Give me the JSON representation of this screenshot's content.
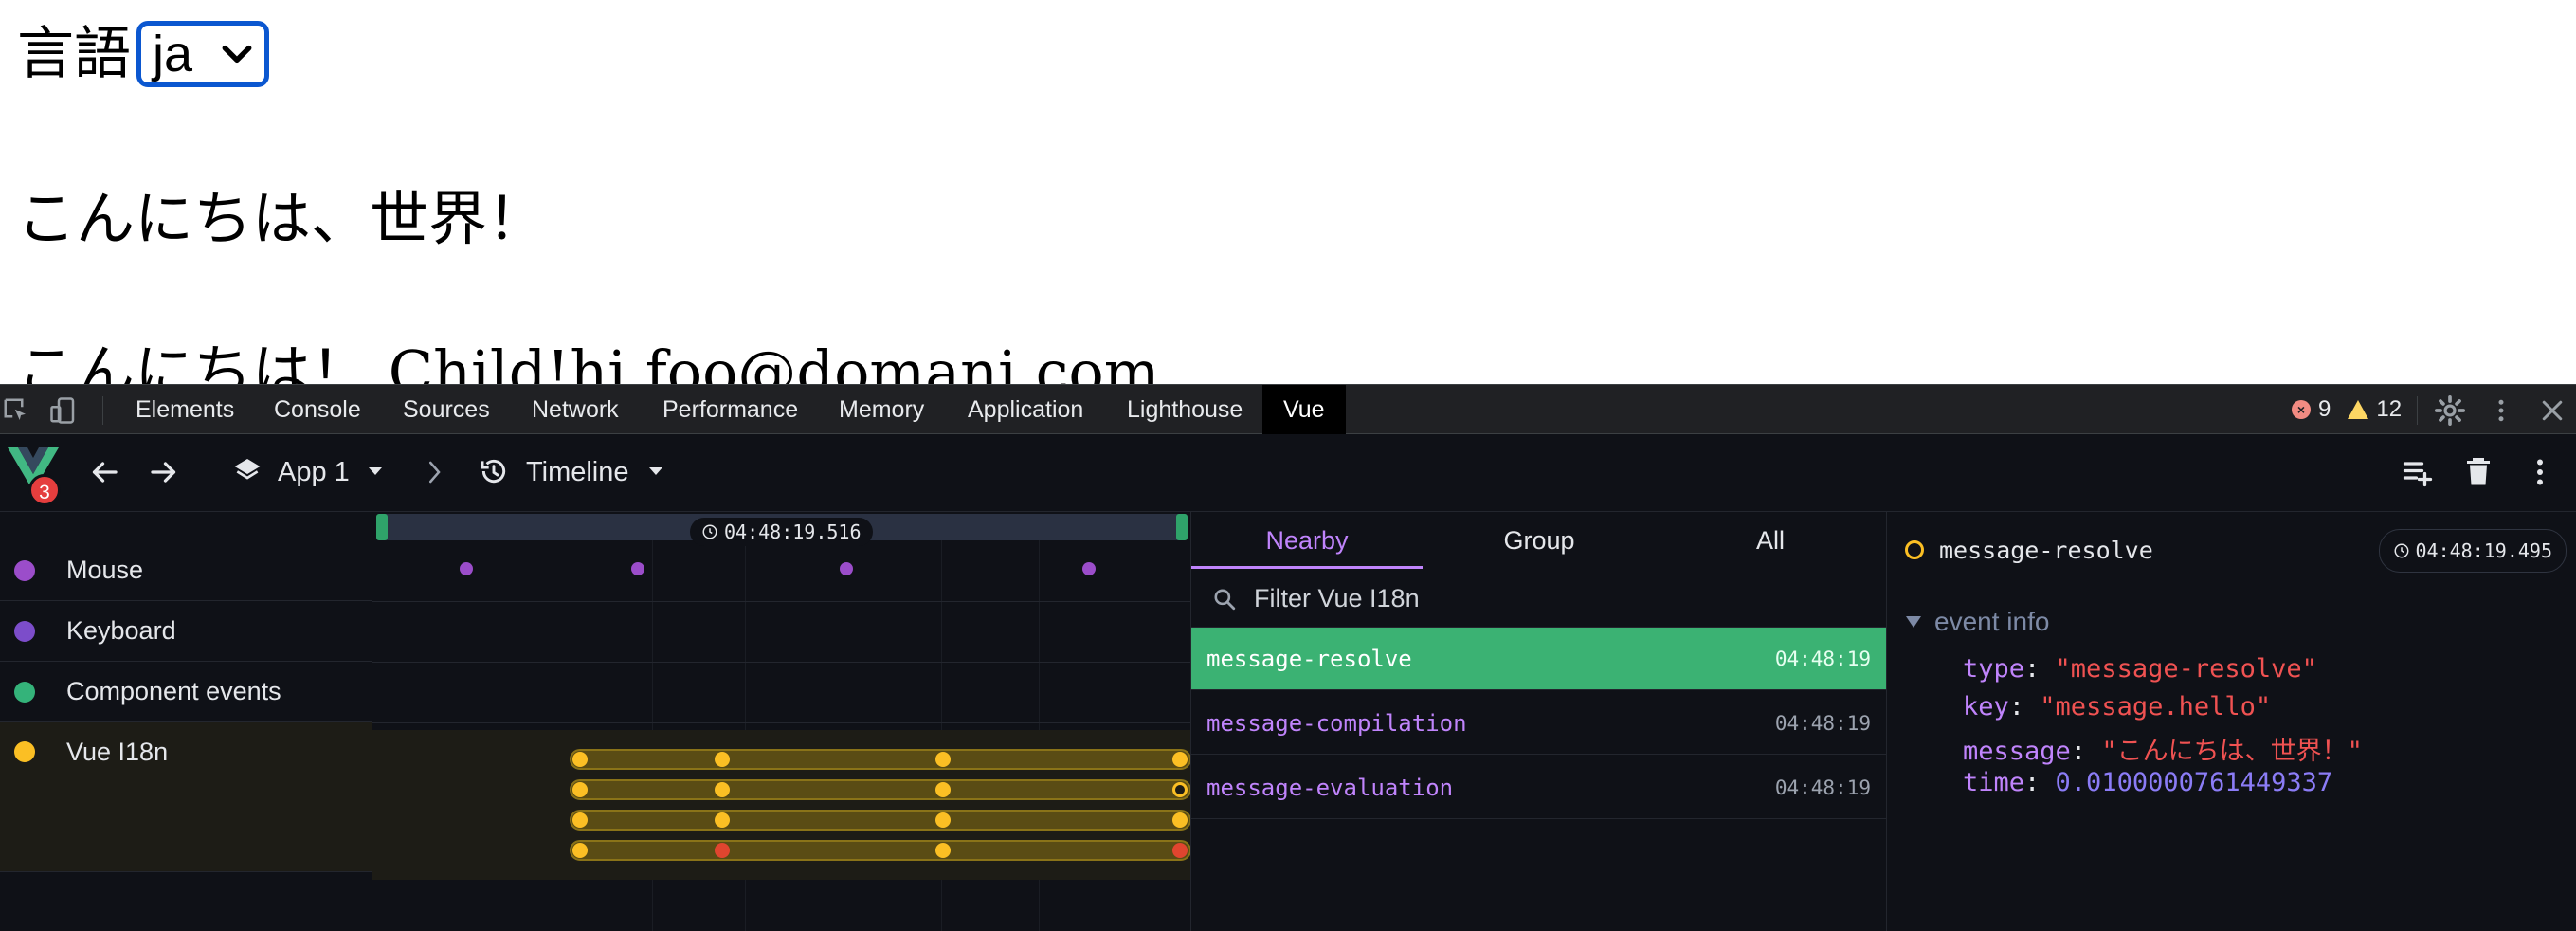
{
  "page": {
    "lang_label": "言語",
    "lang_value": "ja",
    "hello": "こんにちは、世界！",
    "child_line": "こんにちは！ Child!hi foo@domani.com"
  },
  "devtools": {
    "tabs": [
      "Elements",
      "Console",
      "Sources",
      "Network",
      "Performance",
      "Memory",
      "Application",
      "Lighthouse",
      "Vue"
    ],
    "active_tab": "Vue",
    "error_count": "9",
    "warning_count": "12"
  },
  "vue_bar": {
    "badge_count": "3",
    "app_label": "App 1",
    "view_label": "Timeline"
  },
  "layers": [
    {
      "label": "Mouse",
      "color": "#9b4dca"
    },
    {
      "label": "Keyboard",
      "color": "#7c4dca"
    },
    {
      "label": "Component events",
      "color": "#34b37a"
    },
    {
      "label": "Vue I18n",
      "color": "#fbbf24"
    }
  ],
  "timeline": {
    "cursor_time": "04:48:19.516"
  },
  "events_panel": {
    "tabs": [
      "Nearby",
      "Group",
      "All"
    ],
    "active_tab": "Nearby",
    "filter_placeholder": "Filter Vue I18n",
    "events": [
      {
        "name": "message-resolve",
        "time": "04:48:19",
        "selected": true
      },
      {
        "name": "message-compilation",
        "time": "04:48:19",
        "selected": false
      },
      {
        "name": "message-evaluation",
        "time": "04:48:19",
        "selected": false
      }
    ]
  },
  "details": {
    "title": "message-resolve",
    "time": "04:48:19.495",
    "section": "event info",
    "fields": {
      "type_key": "type",
      "type_val": "\"message-resolve\"",
      "key_key": "key",
      "key_val": "\"message.hello\"",
      "message_key": "message",
      "message_val": "\"こんにちは、世界！\"",
      "time_key": "time",
      "time_val": "0.0100000761449337"
    }
  },
  "colors": {
    "accent_green": "#3bb273",
    "accent_purple": "#c084fc",
    "selection_blue": "#0b57d0"
  }
}
